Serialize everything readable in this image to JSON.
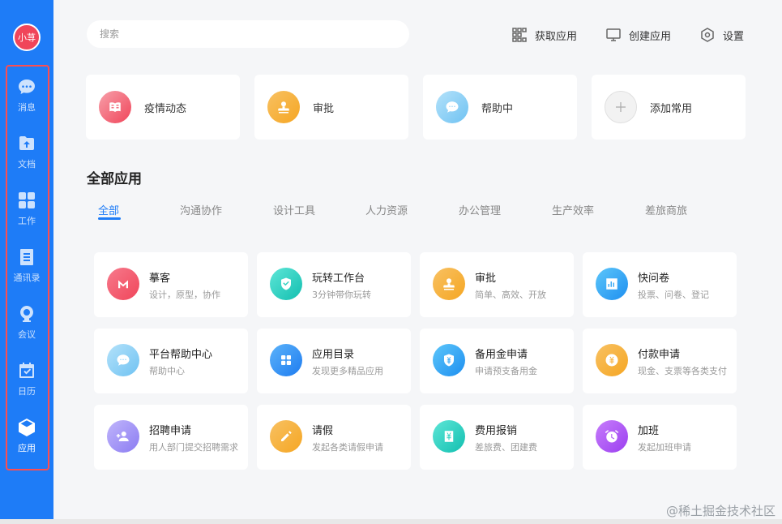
{
  "sidebar": {
    "avatar": "小荨",
    "items": [
      {
        "label": "消息",
        "icon": "message-icon"
      },
      {
        "label": "文档",
        "icon": "folder-upload-icon"
      },
      {
        "label": "工作",
        "icon": "grid-icon"
      },
      {
        "label": "通讯录",
        "icon": "contacts-icon"
      },
      {
        "label": "会议",
        "icon": "camera-icon"
      },
      {
        "label": "日历",
        "icon": "calendar-icon"
      },
      {
        "label": "应用",
        "icon": "cube-icon",
        "active": true
      }
    ]
  },
  "topbar": {
    "search_placeholder": "搜索",
    "get_apps": "获取应用",
    "create_app": "创建应用",
    "settings": "设置"
  },
  "quick": [
    {
      "label": "疫情动态",
      "color": "#f26b7c",
      "icon": "book-icon"
    },
    {
      "label": "审批",
      "color": "#f5a623",
      "icon": "stamp-icon"
    },
    {
      "label": "帮助中",
      "color": "#7ccbf5",
      "icon": "chat-bubble-icon"
    },
    {
      "label": "添加常用",
      "color": "#eeeeee",
      "icon": "plus-icon"
    }
  ],
  "section_title": "全部应用",
  "tabs": [
    "全部",
    "沟通协作",
    "设计工具",
    "人力资源",
    "办公管理",
    "生产效率",
    "差旅商旅"
  ],
  "apps": [
    {
      "name": "摹客",
      "desc": "设计，原型，协作",
      "color": "#f0455a",
      "icon": "m-logo-icon"
    },
    {
      "name": "玩转工作台",
      "desc": "3分钟带你玩转",
      "color": "#20cfc0",
      "icon": "shield-check-icon"
    },
    {
      "name": "审批",
      "desc": "简单、高效、开放",
      "color": "#f5a623",
      "icon": "stamp-icon"
    },
    {
      "name": "快问卷",
      "desc": "投票、问卷、登记",
      "color": "#1ea0f0",
      "icon": "bar-chart-icon"
    },
    {
      "name": "平台帮助中心",
      "desc": "帮助中心",
      "color": "#7ccbf5",
      "icon": "chat-bubble-icon"
    },
    {
      "name": "应用目录",
      "desc": "发现更多精品应用",
      "color": "#1e90f0",
      "icon": "grid-icon"
    },
    {
      "name": "备用金申请",
      "desc": "申请预支备用金",
      "color": "#1ea0f0",
      "icon": "yen-shield-icon"
    },
    {
      "name": "付款申请",
      "desc": "现金、支票等各类支付",
      "color": "#f5a623",
      "icon": "yen-coin-icon"
    },
    {
      "name": "招聘申请",
      "desc": "用人部门提交招聘需求",
      "color": "#9b8cf5",
      "icon": "user-add-icon"
    },
    {
      "name": "请假",
      "desc": "发起各类请假申请",
      "color": "#f5a623",
      "icon": "pencil-icon"
    },
    {
      "name": "费用报销",
      "desc": "差旅费、团建费",
      "color": "#20cfc0",
      "icon": "yen-doc-icon"
    },
    {
      "name": "加班",
      "desc": "发起加班申请",
      "color": "#a855f7",
      "icon": "alarm-icon"
    }
  ],
  "watermark": "@稀土掘金技术社区"
}
